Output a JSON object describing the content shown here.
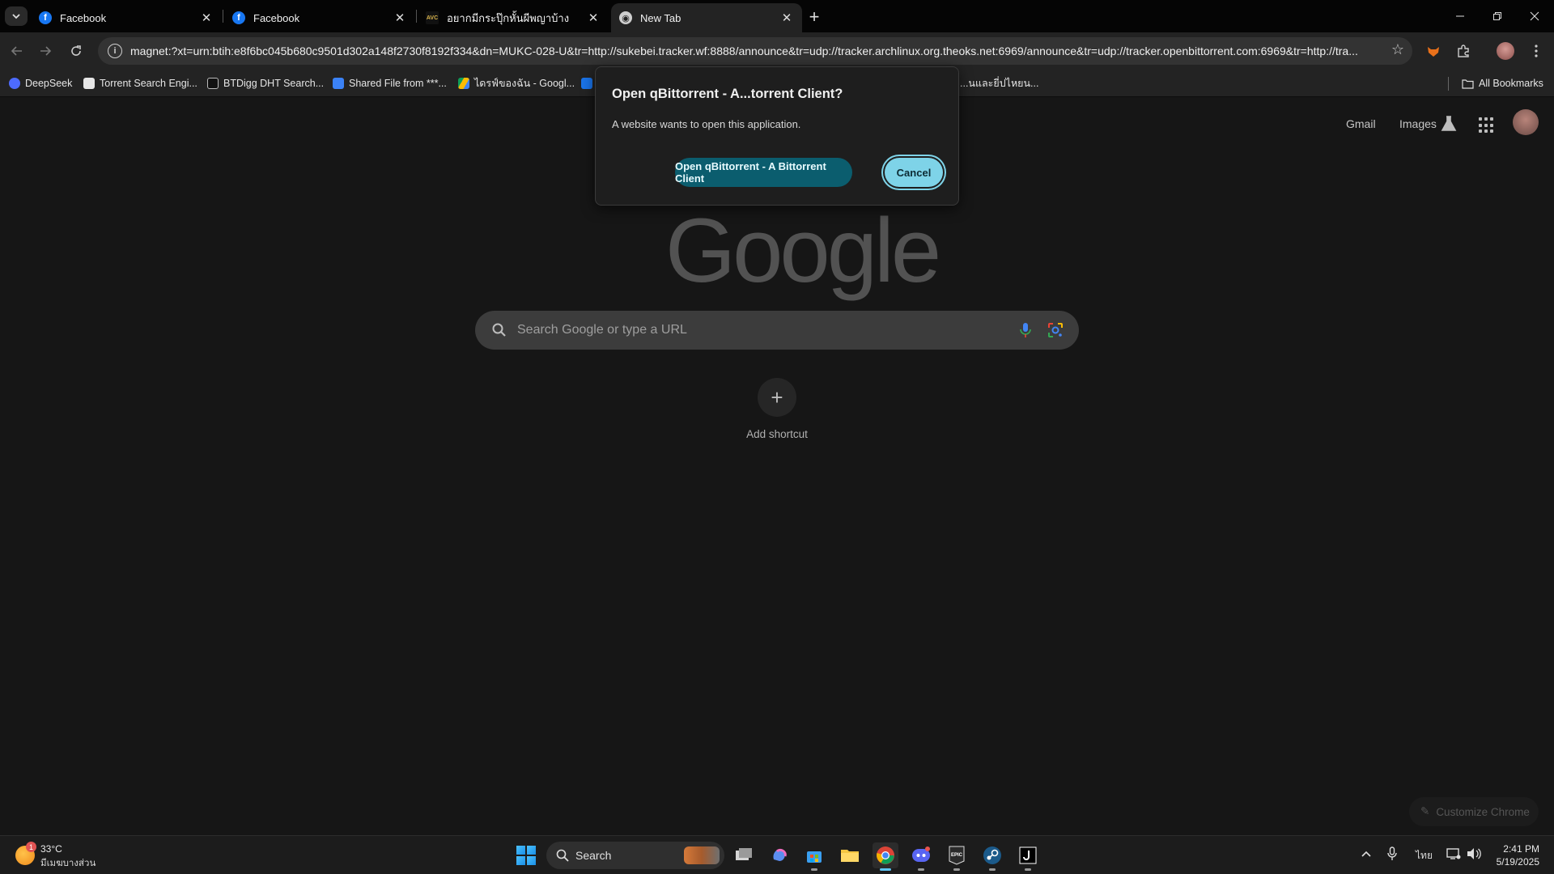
{
  "tabs": [
    {
      "title": "Facebook",
      "favicon": "facebook-icon",
      "active": false
    },
    {
      "title": "Facebook",
      "favicon": "facebook-icon",
      "active": false
    },
    {
      "title": "อยากมีกระปุ๊กหั้นผีพญาบ้าง",
      "favicon": "avc-icon",
      "active": false
    },
    {
      "title": "New Tab",
      "favicon": "chrome-icon",
      "active": true
    }
  ],
  "omnibox": {
    "url": "magnet:?xt=urn:btih:e8f6bc045b680c9501d302a148f2730f8192f334&dn=MUKC-028-U&tr=http://sukebei.tracker.wf:8888/announce&tr=udp://tracker.archlinux.org.theoks.net:6969/announce&tr=udp://tracker.openbittorrent.com:6969&tr=http://tra..."
  },
  "bookmarks": [
    {
      "label": "DeepSeek",
      "color": "#4d6bfe"
    },
    {
      "label": "Torrent Search Engi...",
      "color": "#e6e6e6"
    },
    {
      "label": "BTDigg DHT Search...",
      "color": "#e6e6e6"
    },
    {
      "label": "Shared File from ***...",
      "color": "#3b82f6"
    },
    {
      "label": "ไดรฟ์ของฉัน - Googl...",
      "color": "#fbbc04"
    },
    {
      "label": "...นและยี่ปไหยน...",
      "color": "#1a73e8"
    }
  ],
  "all_bookmarks_label": "All Bookmarks",
  "ntp": {
    "gmail_label": "Gmail",
    "images_label": "Images",
    "logo_text": "Google",
    "search_placeholder": "Search Google or type a URL",
    "add_shortcut_label": "Add shortcut",
    "customize_label": "Customize Chrome"
  },
  "dialog": {
    "title": "Open qBittorrent - A...torrent Client?",
    "body": "A website wants to open this application.",
    "open_label": "Open qBittorrent - A Bittorrent Client",
    "cancel_label": "Cancel"
  },
  "taskbar": {
    "weather_temp": "33°C",
    "weather_condition": "มีเมฆบางส่วน",
    "weather_badge": "1",
    "search_label": "Search",
    "language": "ไทย",
    "time": "2:41 PM",
    "date": "5/19/2025"
  },
  "colors": {
    "accent_open": "#0b5d6e",
    "accent_cancel": "#7ed3e8",
    "page_bg": "#161616"
  }
}
